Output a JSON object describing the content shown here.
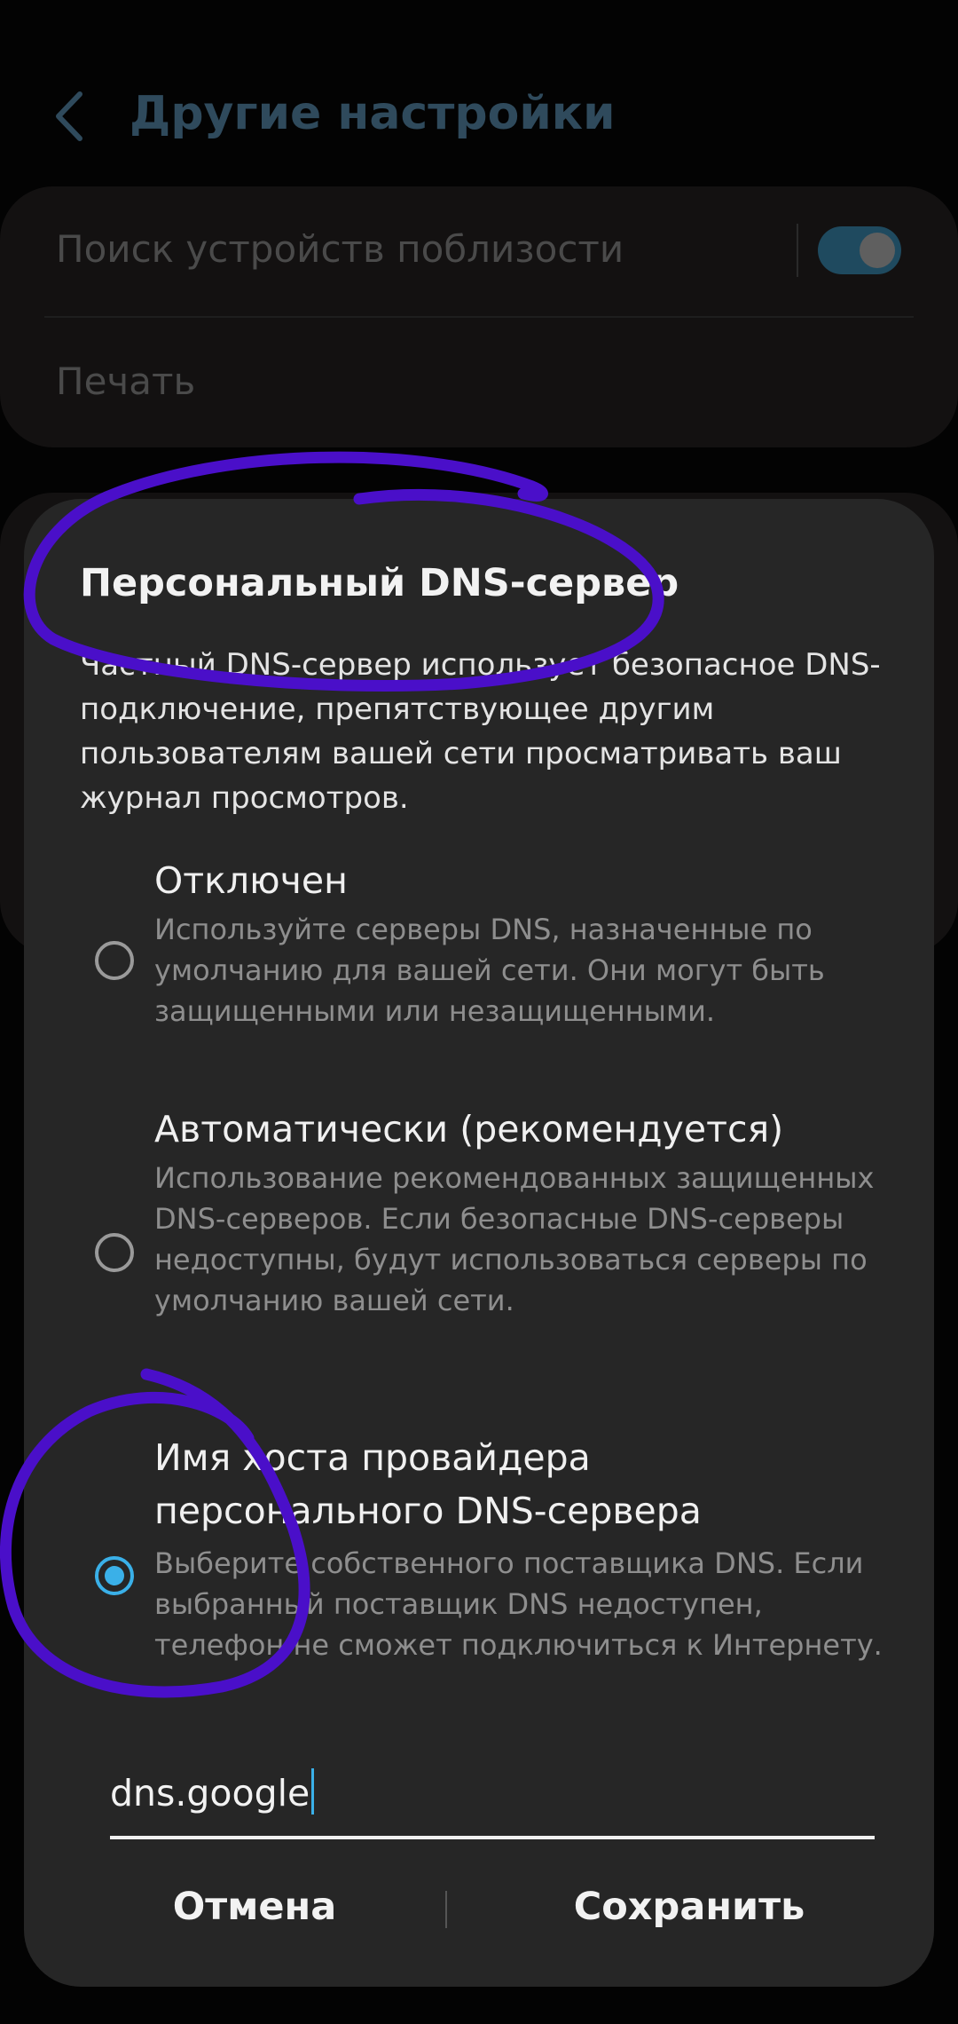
{
  "header": {
    "title": "Другие настройки",
    "back_icon": "chevron-left-icon"
  },
  "settings": {
    "nearby_scan_label": "Поиск устройств поблизости",
    "nearby_scan_enabled": true,
    "print_label": "Печать"
  },
  "dialog": {
    "title": "Персональный DNS-сервер",
    "description": "Частный DNS-сервер использует безопасное DNS-подключение, препятствующее другим пользователям вашей сети просматривать ваш журнал просмотров.",
    "options": [
      {
        "label": "Отключен",
        "sublabel": "Используйте серверы DNS, назначенные по умолчанию для вашей сети. Они могут быть защищенными или незащищенными.",
        "selected": false
      },
      {
        "label": "Автоматически (рекомендуется)",
        "sublabel": "Использование рекомендованных защищенных DNS-серверов. Если безопасные DNS-серверы недоступны, будут использоваться серверы по умолчанию вашей сети.",
        "selected": false
      },
      {
        "label": "Имя хоста провайдера персонального DNS-сервера",
        "sublabel": "Выберите собственного поставщика DNS. Если выбранный поставщик DNS недоступен, телефон не сможет подключиться к Интернету.",
        "selected": true
      }
    ],
    "hostname_value": "dns.google",
    "cancel_label": "Отмена",
    "save_label": "Сохранить"
  },
  "colors": {
    "accent": "#3ab0e8",
    "dialog_bg": "#262626",
    "scribble": "#4a0fc9"
  }
}
